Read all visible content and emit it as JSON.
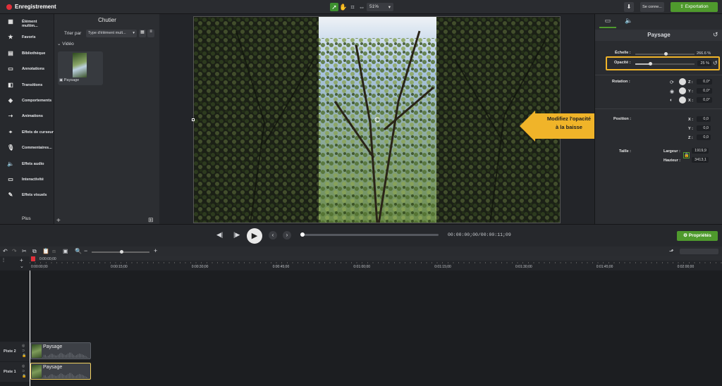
{
  "app": {
    "title": "Enregistrement",
    "zoom": "51%",
    "sign_in": "Se conne...",
    "export": "Exportation"
  },
  "nav": {
    "items": [
      {
        "label": "Élément multim...",
        "icon": "media-icon",
        "glyph": "▦"
      },
      {
        "label": "Favoris",
        "icon": "star-icon",
        "glyph": "★"
      },
      {
        "label": "Bibliothèque",
        "icon": "library-icon",
        "glyph": "▤"
      },
      {
        "label": "Annotations",
        "icon": "annotation-icon",
        "glyph": "▭"
      },
      {
        "label": "Transitions",
        "icon": "transition-icon",
        "glyph": "◧"
      },
      {
        "label": "Comportements",
        "icon": "behavior-icon",
        "glyph": "◈"
      },
      {
        "label": "Animations",
        "icon": "animation-icon",
        "glyph": "➝"
      },
      {
        "label": "Effets de curseur",
        "icon": "cursor-icon",
        "glyph": "⌖"
      },
      {
        "label": "Commentaires...",
        "icon": "microphone-icon",
        "glyph": "🎙"
      },
      {
        "label": "Effets audio",
        "icon": "speaker-icon",
        "glyph": "🔈"
      },
      {
        "label": "Interactivité",
        "icon": "interactivity-icon",
        "glyph": "▭"
      },
      {
        "label": "Effets visuels",
        "icon": "wand-icon",
        "glyph": "✎"
      }
    ],
    "more": "Plus"
  },
  "bin": {
    "title": "Chutier",
    "sort_label": "Trier par",
    "sort_value": "Type d'élément mult...",
    "group": "Vidéo",
    "clip_name": "Paysage"
  },
  "callout": {
    "line1": "Modifiez l'opacité",
    "line2": "à la baisse"
  },
  "props": {
    "title": "Paysage",
    "scale_label": "Échelle :",
    "scale_value": "266.6 %",
    "opacity_label": "Opacité :",
    "opacity_value": "25 %",
    "opacity_level": 0.25,
    "rotation_label": "Rotation :",
    "rot_z": "Z :",
    "rot_z_val": "0,0°",
    "rot_y": "Y :",
    "rot_y_val": "0,0°",
    "rot_x": "X :",
    "rot_x_val": "0,0°",
    "position_label": "Position :",
    "pos_x": "X :",
    "pos_x_val": "0,0",
    "pos_y": "Y :",
    "pos_y_val": "0,0",
    "pos_z": "Z :",
    "pos_z_val": "0,0",
    "size_label": "Taille :",
    "width_label": "Largeur :",
    "width_val": "1919,9",
    "height_label": "Hauteur :",
    "height_val": "3413,1"
  },
  "transport": {
    "time": "00:00:00;00/00:00:11;09",
    "properties": "Propriétés"
  },
  "timeline": {
    "playhead": "0:00:00;00",
    "ticks": [
      "0:00:00;00",
      "0:00:15;00",
      "0:00:30;00",
      "0:00:45;00",
      "0:01:00;00",
      "0:01:15;00",
      "0:01:30;00",
      "0:01:45;00",
      "0:02:00;00"
    ],
    "tracks": [
      {
        "label": "Piste 2",
        "clip": "Paysage"
      },
      {
        "label": "Piste 1",
        "clip": "Paysage"
      }
    ]
  },
  "colors": {
    "accent": "#4f9a2d",
    "callout": "#f0b429",
    "record": "#e0303a"
  }
}
